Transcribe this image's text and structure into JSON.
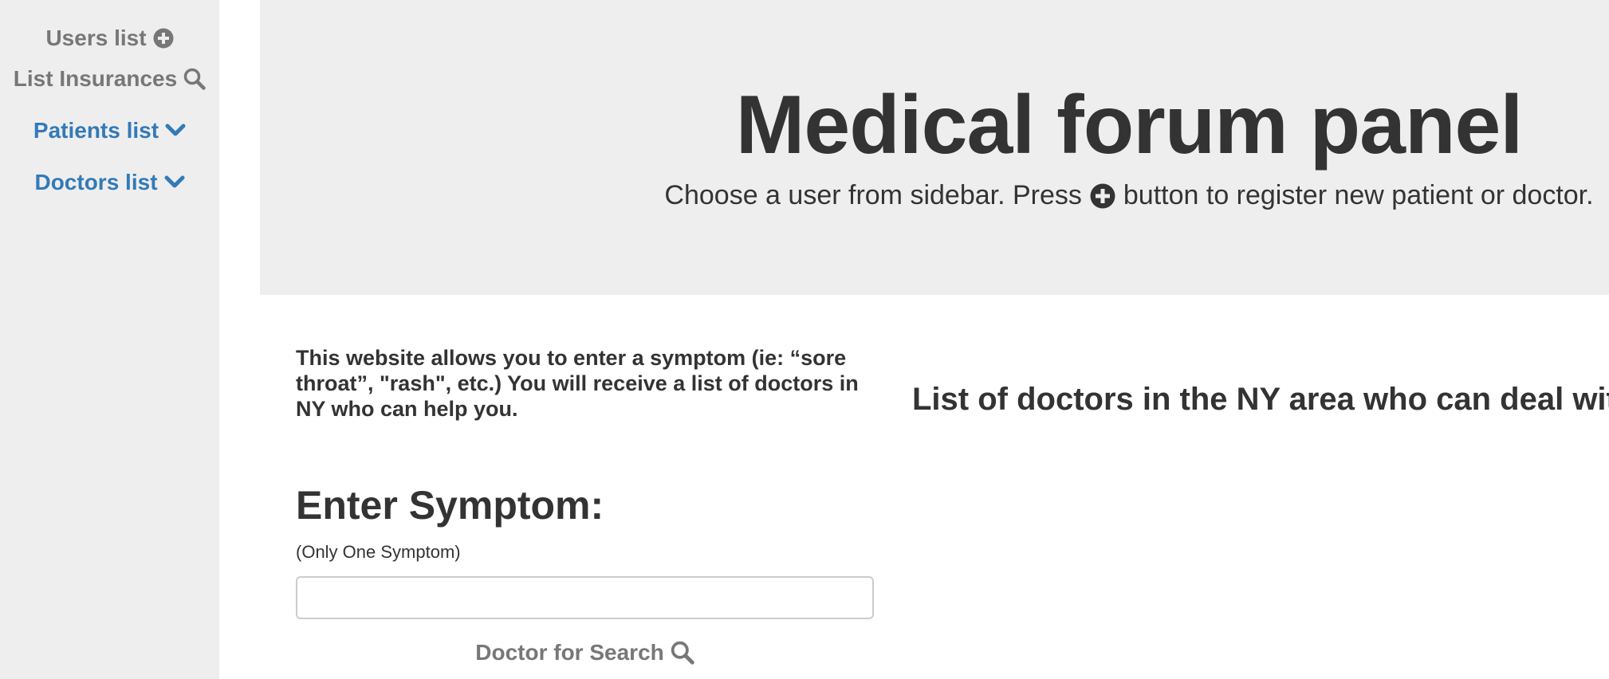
{
  "sidebar": {
    "items": [
      {
        "label": "Users list",
        "icon": "plus-circle-icon"
      },
      {
        "label": "List Insurances",
        "icon": "search-icon"
      },
      {
        "label": "Patients list",
        "icon": "chevron-down-icon"
      },
      {
        "label": "Doctors list",
        "icon": "chevron-down-icon"
      }
    ]
  },
  "header": {
    "title": "Medical forum panel",
    "subtitle_before": "Choose a user from sidebar. Press",
    "subtitle_icon": "plus-circle-icon",
    "subtitle_after": "button to register new patient or doctor."
  },
  "main": {
    "intro": "This website allows you to enter a symptom (ie: “sore throat”, \"rash\", etc.) You will receive a list of doctors in NY who can help you.",
    "results_title": "List of doctors in the NY area who can deal with",
    "results_colon": ":",
    "enter_title": "Enter Symptom:",
    "hint": "(Only One Symptom)",
    "symptom_value": "",
    "search_label": "Doctor for Search",
    "search_icon": "search-icon"
  },
  "colors": {
    "panel_bg": "#eeeeee",
    "link_blue": "#337ab7",
    "muted_gray": "#777777",
    "text_dark": "#333333"
  }
}
